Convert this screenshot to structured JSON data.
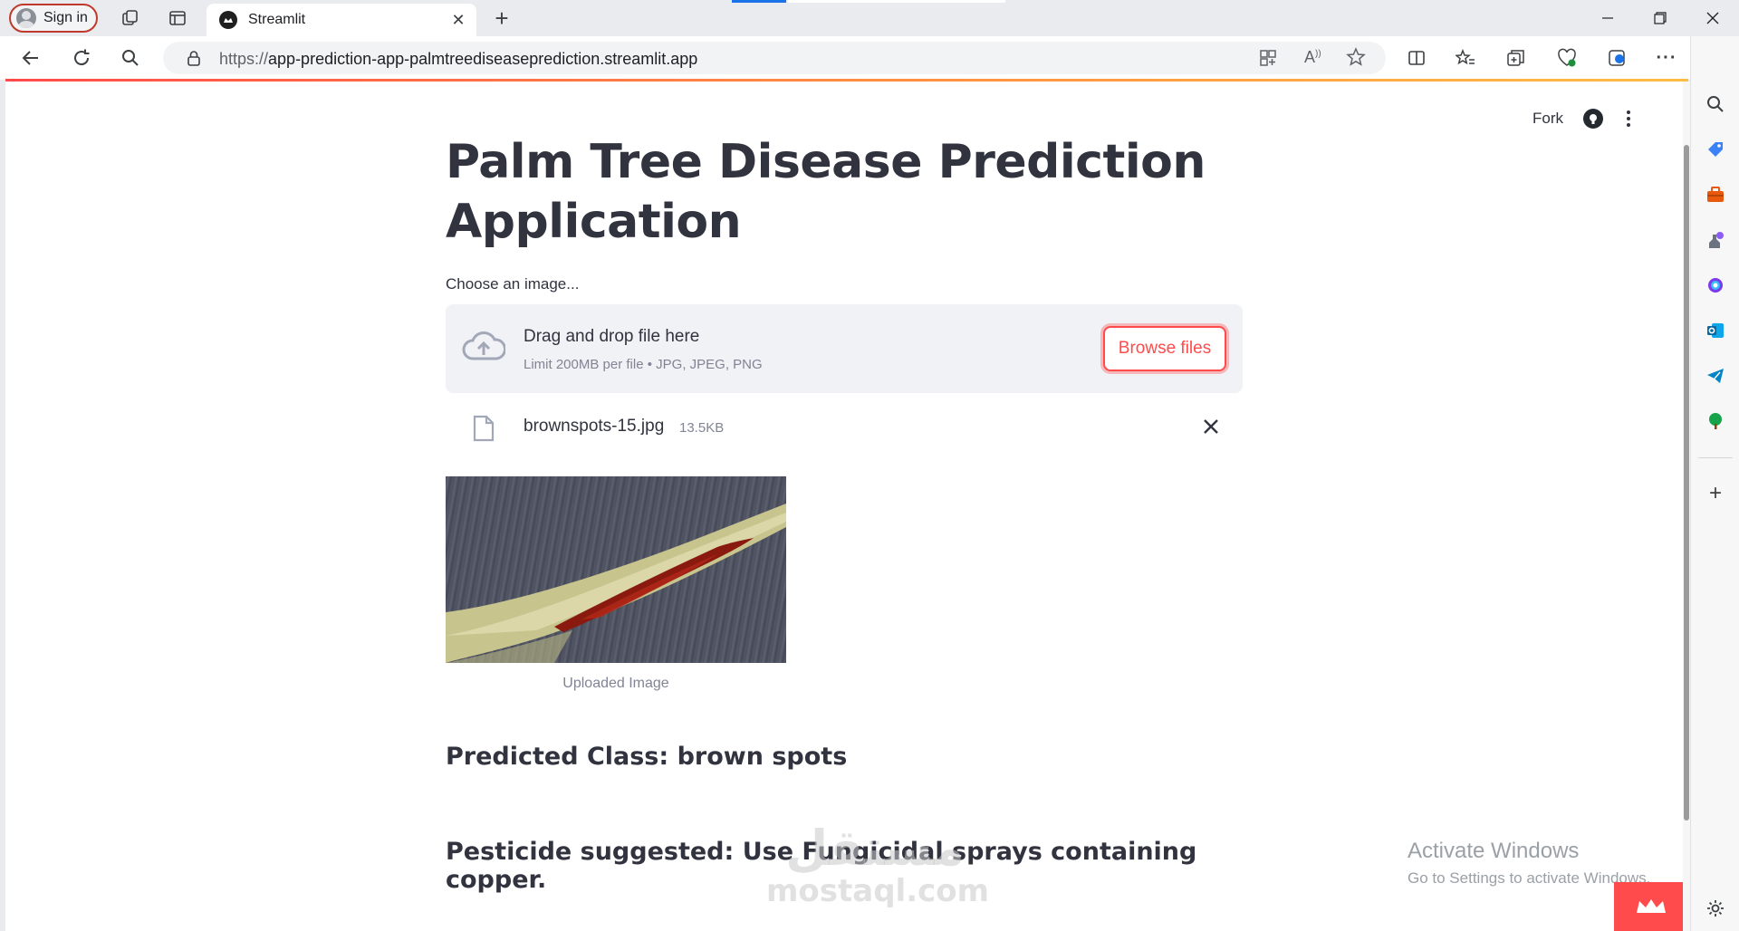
{
  "browser": {
    "signin_label": "Sign in",
    "tab_title": "Streamlit",
    "url_scheme": "https://",
    "url_host": "app-prediction-app-palmtreediseaseprediction.streamlit.app",
    "new_tab_label": "+"
  },
  "header": {
    "fork_label": "Fork"
  },
  "main": {
    "title": "Palm Tree Disease Prediction Application",
    "uploader": {
      "label": "Choose an image...",
      "drag_text": "Drag and drop file here",
      "limit_text": "Limit 200MB per file • JPG, JPEG, PNG",
      "browse_label": "Browse files"
    },
    "file": {
      "name": "brownspots-15.jpg",
      "size": "13.5KB"
    },
    "image_caption": "Uploaded Image",
    "predicted": "Predicted Class: brown spots",
    "pesticide": "Pesticide suggested: Use Fungicidal sprays containing copper."
  },
  "overlay": {
    "watermark_ar": "مستقل",
    "watermark_en": "mostaql.com",
    "activate_title": "Activate Windows",
    "activate_sub": "Go to Settings to activate Windows."
  },
  "colors": {
    "accent": "#ff4b4b",
    "text": "#31333f",
    "muted": "#808495",
    "dropzone_bg": "#f0f2f6"
  },
  "icons": {
    "back": "arrow-left-icon",
    "refresh": "refresh-icon",
    "search": "search-icon",
    "lock": "lock-icon",
    "github": "github-icon",
    "cloud_upload": "cloud-upload-icon",
    "file": "file-icon",
    "close": "close-icon"
  }
}
